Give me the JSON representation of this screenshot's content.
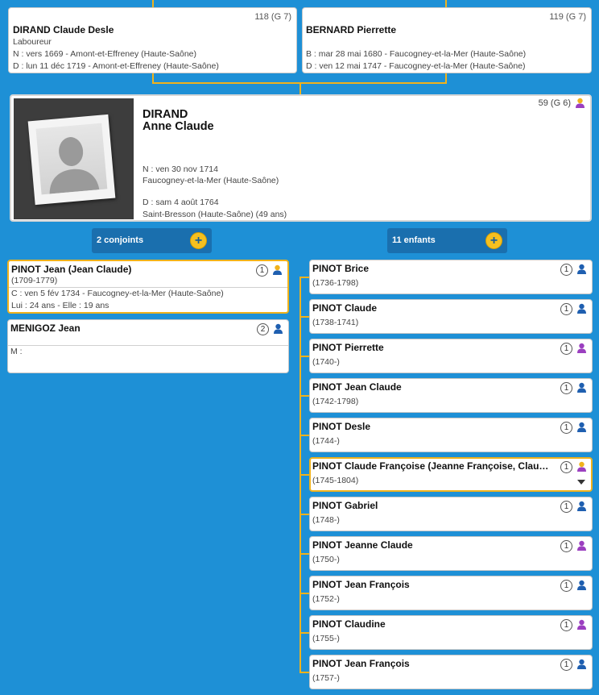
{
  "father": {
    "name": "DIRAND Claude Desle",
    "ref": "118 (G 7)",
    "occupation": "Laboureur",
    "birth": "N : vers 1669 - Amont-et-Effreney (Haute-Saône)",
    "death": "D : lun 11 déc 1719 - Amont-et-Effreney (Haute-Saône)"
  },
  "mother": {
    "name": "BERNARD Pierrette",
    "ref": "119 (G 7)",
    "birth": "B : mar 28 mai 1680 - Faucogney-et-la-Mer (Haute-Saône)",
    "death": "D : ven 12 mai 1747 - Faucogney-et-la-Mer (Haute-Saône)"
  },
  "person": {
    "surname": "DIRAND",
    "given": "Anne Claude",
    "ref": "59 (G 6)",
    "birth_date": "N : ven 30 nov 1714",
    "birth_place": "Faucogney-et-la-Mer (Haute-Saône)",
    "death_date": "D : sam 4 août 1764",
    "death_place": "Saint-Bresson (Haute-Saône) (49 ans)"
  },
  "spouses_pill": {
    "label": "2 conjoints",
    "plus": "+"
  },
  "children_pill": {
    "label": "11 enfants",
    "plus": "+"
  },
  "spouses": [
    {
      "name": "PINOT Jean (Jean Claude)",
      "dates": "(1709-1779)",
      "num": "1",
      "marriage": "C : ven 5 fév 1734 - Faucogney-et-la-Mer (Haute-Saône)",
      "ages": "Lui : 24 ans - Elle : 19 ans"
    },
    {
      "name": "MENIGOZ Jean",
      "num": "2",
      "marriage": "M :"
    }
  ],
  "children": [
    {
      "name": "PINOT Brice",
      "dates": "(1736-1798)",
      "num": "1",
      "sex": "m"
    },
    {
      "name": "PINOT Claude",
      "dates": "(1738-1741)",
      "num": "1",
      "sex": "m"
    },
    {
      "name": "PINOT Pierrette",
      "dates": "(1740-)",
      "num": "1",
      "sex": "f"
    },
    {
      "name": "PINOT Jean Claude",
      "dates": "(1742-1798)",
      "num": "1",
      "sex": "m"
    },
    {
      "name": "PINOT Desle",
      "dates": "(1744-)",
      "num": "1",
      "sex": "m"
    },
    {
      "name": "PINOT Claude Françoise  (Jeanne Françoise, Claudine Françoise)",
      "dates": "(1745-1804)",
      "num": "1",
      "sex": "f"
    },
    {
      "name": "PINOT Gabriel",
      "dates": "(1748-)",
      "num": "1",
      "sex": "m"
    },
    {
      "name": "PINOT Jeanne Claude",
      "dates": "(1750-)",
      "num": "1",
      "sex": "f"
    },
    {
      "name": "PINOT Jean François",
      "dates": "(1752-)",
      "num": "1",
      "sex": "m"
    },
    {
      "name": "PINOT Claudine",
      "dates": "(1755-)",
      "num": "1",
      "sex": "f"
    },
    {
      "name": "PINOT Jean François",
      "dates": "(1757-)",
      "num": "1",
      "sex": "m"
    }
  ],
  "colors": {
    "background": "#1e90d6",
    "accent": "#f0b21c",
    "male": "#1f5fb0",
    "female": "#9b3fc0",
    "root": "#f0b21c"
  }
}
